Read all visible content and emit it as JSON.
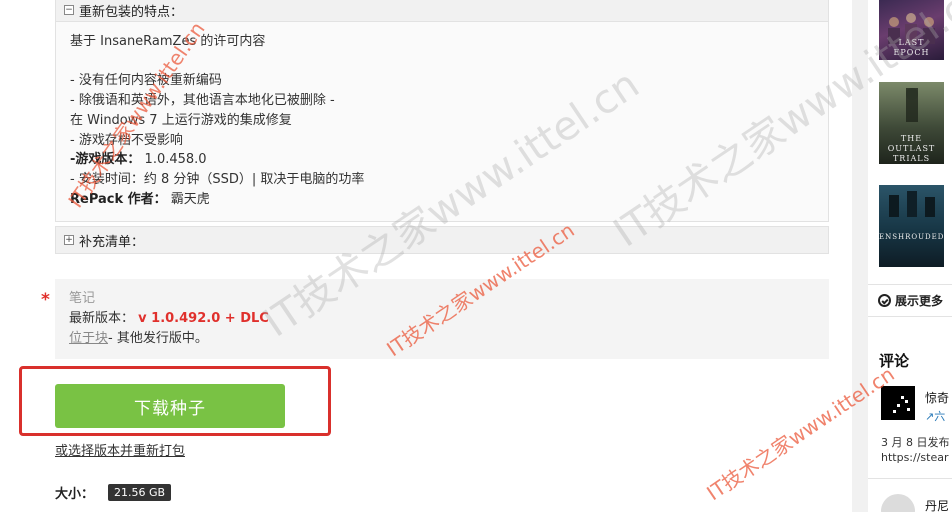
{
  "spoiler_features": {
    "title": "重新包装的特点：",
    "toggle": "−",
    "lines": [
      "基于 InsaneRamZes 的许可内容",
      "",
      "- 没有任何内容被重新编码",
      "- 除俄语和英语外，其他语言本地化已被删除 -",
      "在 Windows 7 上运行游戏的集成修复",
      "- 游戏存档不受影响"
    ],
    "version_label": "-游戏版本：",
    "version_value": "1.0.458.0",
    "install_time": "- 安装时间：约 8 分钟（SSD）| 取决于电脑的功率",
    "author_label": "RePack 作者：",
    "author_value": "霸天虎"
  },
  "spoiler_extra": {
    "title": "补充清单：",
    "toggle": "+"
  },
  "note": {
    "asterisk": "*",
    "label": "笔记",
    "latest_label": "最新版本：",
    "latest_value": "v 1.0.492.0 + DLC",
    "location_link": "位于块",
    "location_rest": "- 其他发行版中。"
  },
  "download": {
    "button_label": "下载种子",
    "repack_link": "或选择版本并重新打包",
    "size_label": "大小：",
    "size_value": "21.56 GB"
  },
  "sidebar": {
    "games": [
      {
        "title": "LAST EPOCH"
      },
      {
        "title": "THE OUTLAST TRIALS"
      },
      {
        "title": "ENSHROUDED"
      }
    ],
    "show_more": "展示更多",
    "comments_title": "评论",
    "comment1": {
      "user": "惊奇",
      "sub": "六",
      "date": "3 月 8 日发布",
      "url": "https://stear"
    },
    "comment2": {
      "user": "丹尼"
    }
  },
  "watermark": {
    "text": "IT技术之家www.ittel.cn"
  },
  "colors": {
    "accent_green": "#79c244",
    "highlight_red": "#d9302c",
    "version_red": "#e0302c"
  }
}
